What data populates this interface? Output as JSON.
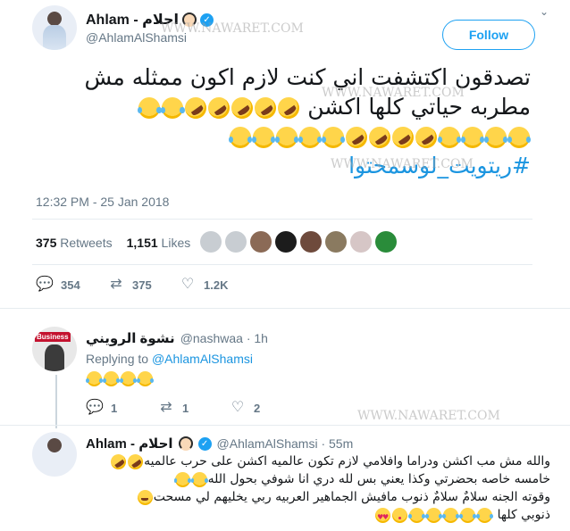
{
  "tweet": {
    "display_name": "Ahlam - احلام",
    "handle": "@AhlamAlShamsi",
    "follow_label": "Follow",
    "text_line1": "تصدقون اكتشفت اني كنت لازم اكون ممثله مش",
    "text_line2": "مطربه حياتي كلها اكشن",
    "hashtag": "#ريتويت_لوسمحتوا",
    "timestamp": "12:32 PM - 25 Jan 2018",
    "retweets_count": "375",
    "retweets_label": "Retweets",
    "likes_count": "1,151",
    "likes_label": "Likes",
    "replies_action": "354",
    "retweets_action": "375",
    "likes_action": "1.2K"
  },
  "reply1": {
    "display_name": "نشوة الرويني",
    "handle": "@nashwaa · 1h",
    "replying_prefix": "Replying to",
    "replying_handle": "@AhlamAlShamsi",
    "replies_action": "1",
    "retweets_action": "1",
    "likes_action": "2"
  },
  "reply2": {
    "display_name": "Ahlam - احلام",
    "handle": "@AhlamAlShamsi · 55m",
    "line1": "والله مش مب اكشن ودراما وافلامي لازم تكون عالميه اكشن على حرب عالميه",
    "line2": "خامسه خاصه بحضرتي وكذا يعني بس لله دري انا شوفي بحول الله",
    "line3": "وقوته الجنه سلامٌ سلامٌ ذنوب مافيش الجماهير العربيه ربي يخليهم لي مسحت",
    "line4": "ذنوبي كلها"
  },
  "watermark": "WWW.NAWARET.COM",
  "icons": [
    "verified-badge-icon",
    "chevron-down-icon",
    "reply-icon",
    "retweet-icon",
    "heart-icon"
  ],
  "colors": {
    "accent": "#1da1f2",
    "link": "#1b95e0",
    "muted": "#657786",
    "text": "#14171a"
  }
}
